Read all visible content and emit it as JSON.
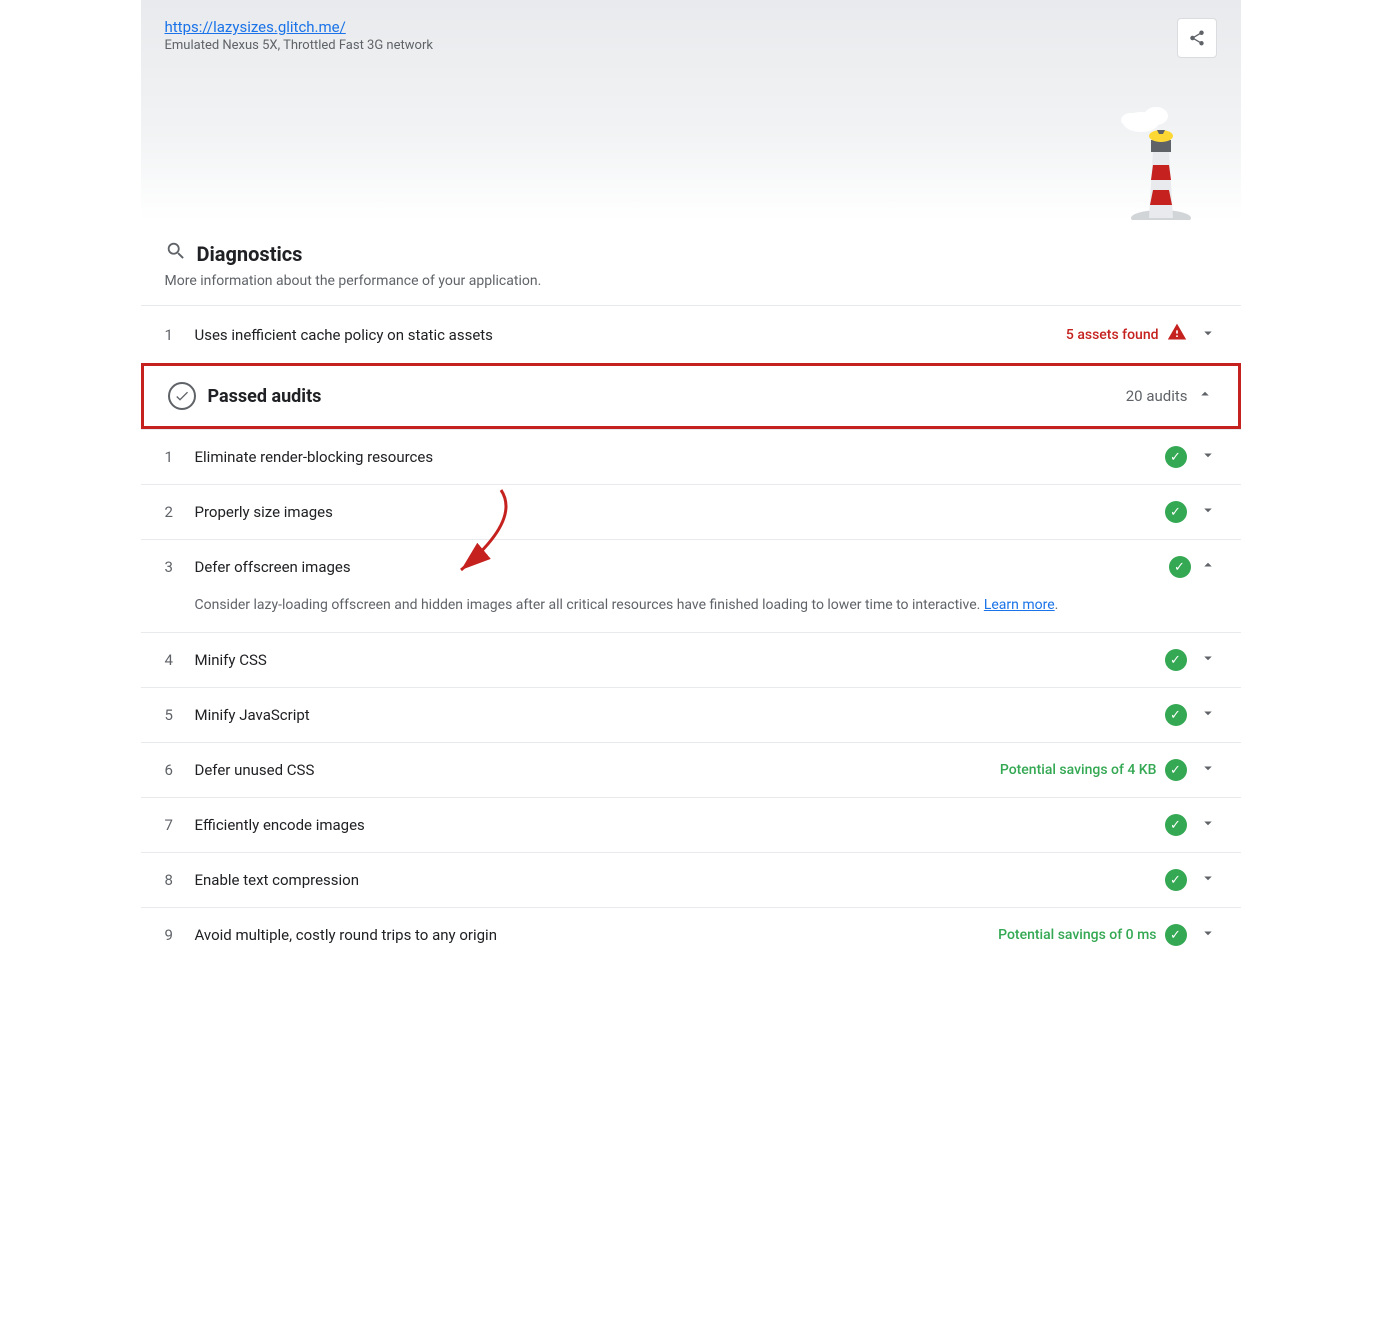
{
  "header": {
    "url": "https://lazysizes.glitch.me/",
    "subtitle": "Emulated Nexus 5X, Throttled Fast 3G network",
    "share_label": "Share"
  },
  "diagnostics": {
    "title": "Diagnostics",
    "description": "More information about the performance of your application.",
    "icon": "search-icon"
  },
  "diagnostics_items": [
    {
      "num": "1",
      "title": "Uses inefficient cache policy on static assets",
      "meta": "5 assets found",
      "meta_type": "warning",
      "expanded": false
    }
  ],
  "passed_audits": {
    "title": "Passed audits",
    "count": "20 audits"
  },
  "passed_items": [
    {
      "num": "1",
      "title": "Eliminate render-blocking resources",
      "meta_type": "check",
      "expanded": false
    },
    {
      "num": "2",
      "title": "Properly size images",
      "meta_type": "check",
      "expanded": false
    },
    {
      "num": "3",
      "title": "Defer offscreen images",
      "meta_type": "check",
      "expanded": true,
      "detail": "Consider lazy-loading offscreen and hidden images after all critical resources have finished loading to lower time to interactive.",
      "learn_more": "Learn more"
    },
    {
      "num": "4",
      "title": "Minify CSS",
      "meta_type": "check",
      "expanded": false
    },
    {
      "num": "5",
      "title": "Minify JavaScript",
      "meta_type": "check",
      "expanded": false
    },
    {
      "num": "6",
      "title": "Defer unused CSS",
      "meta_type": "check_savings",
      "savings": "Potential savings of 4 KB",
      "expanded": false
    },
    {
      "num": "7",
      "title": "Efficiently encode images",
      "meta_type": "check",
      "expanded": false
    },
    {
      "num": "8",
      "title": "Enable text compression",
      "meta_type": "check",
      "expanded": false
    },
    {
      "num": "9",
      "title": "Avoid multiple, costly round trips to any origin",
      "meta_type": "check_savings",
      "savings": "Potential savings of 0 ms",
      "expanded": false
    }
  ],
  "icons": {
    "search": "🔍",
    "check": "✓",
    "warning": "⚠",
    "chevron_down": "∨",
    "chevron_up": "∧",
    "share": "↗"
  },
  "colors": {
    "red": "#c5221f",
    "green": "#34a853",
    "gray": "#5f6368",
    "blue": "#1a73e8"
  }
}
